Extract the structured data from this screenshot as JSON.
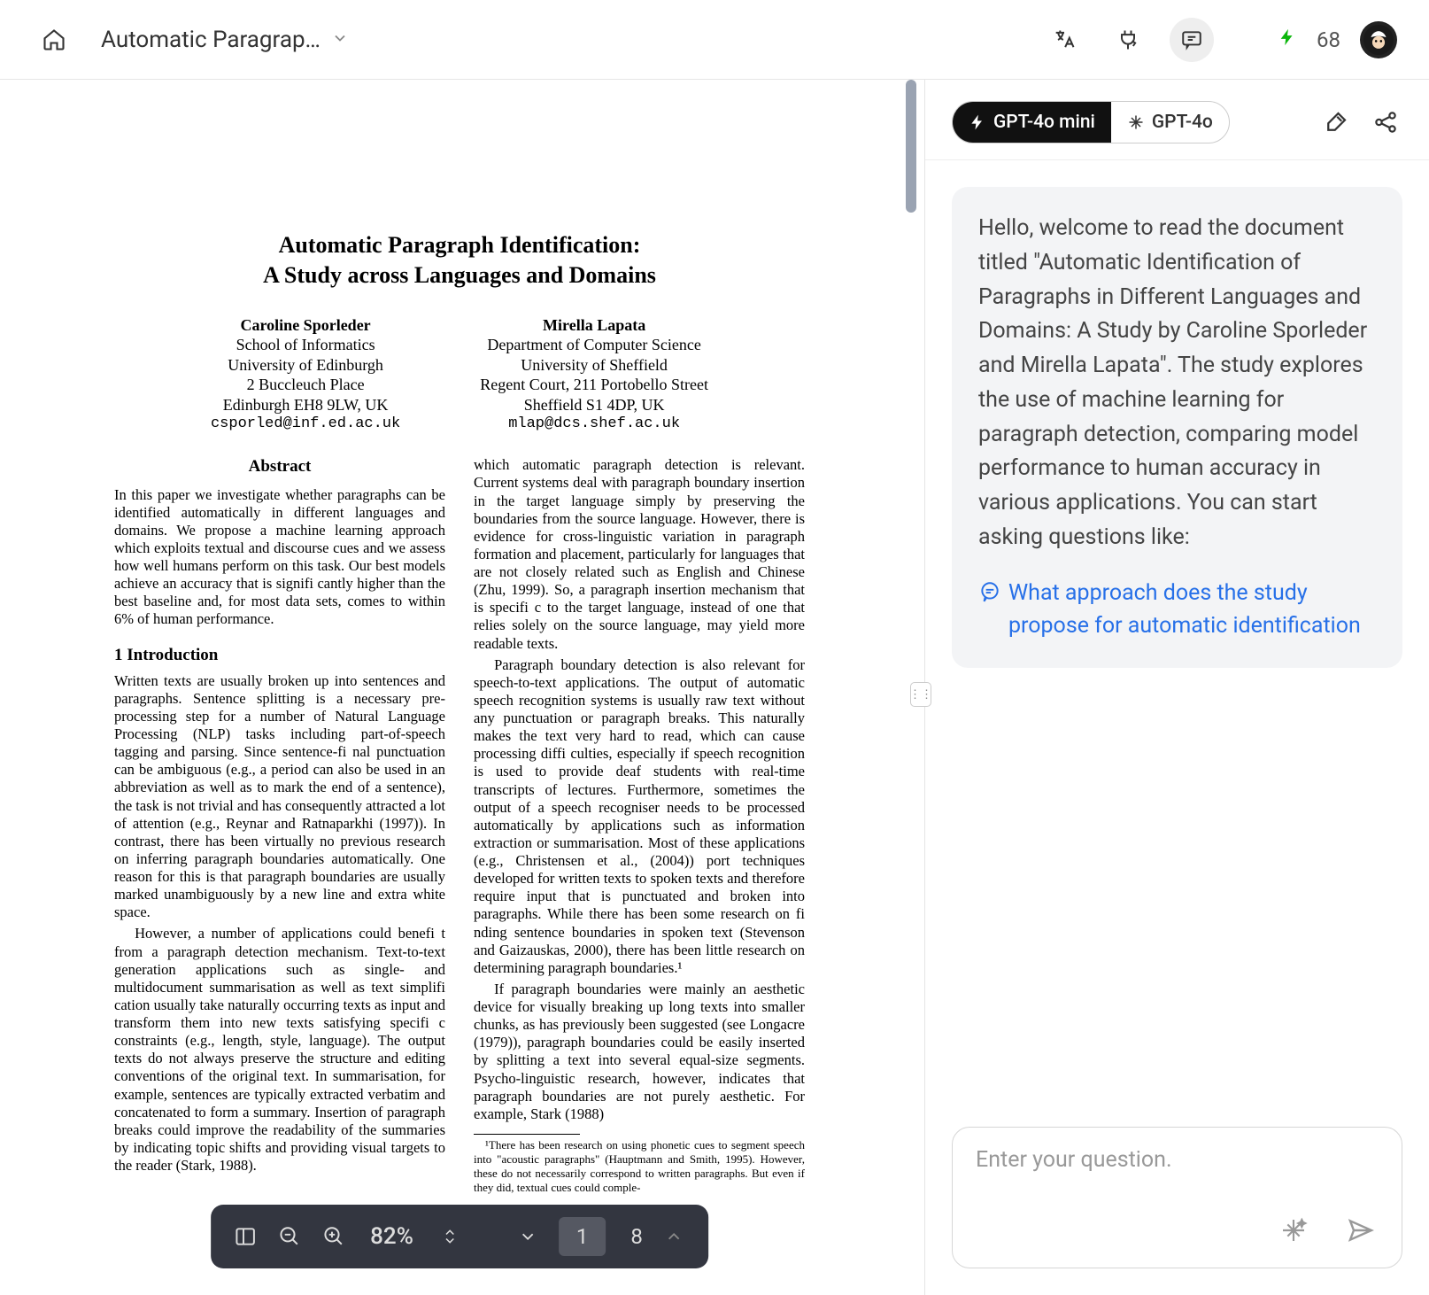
{
  "header": {
    "doc_title": "Automatic Paragrap…",
    "token_count": "68"
  },
  "pdf": {
    "toolbar": {
      "zoom": "82%",
      "current_page": "1",
      "total_pages": "8"
    },
    "paper": {
      "title_line1": "Automatic Paragraph Identification:",
      "title_line2": "A Study across Languages and Domains",
      "authors": [
        {
          "name": "Caroline Sporleder",
          "line1": "School of Informatics",
          "line2": "University of Edinburgh",
          "line3": "2 Buccleuch Place",
          "line4": "Edinburgh EH8 9LW, UK",
          "email": "csporled@inf.ed.ac.uk"
        },
        {
          "name": "Mirella Lapata",
          "line1": "Department of Computer Science",
          "line2": "University of Sheffield",
          "line3": "Regent Court, 211 Portobello Street",
          "line4": "Sheffield S1 4DP, UK",
          "email": "mlap@dcs.shef.ac.uk"
        }
      ],
      "abstract_heading": "Abstract",
      "abstract_body": "In this paper we investigate whether paragraphs can be identified automatically in different languages and domains. We propose a machine learning approach which exploits textual and discourse cues and we assess how well humans perform on this task. Our best models achieve an accuracy that is signifi cantly higher than the best baseline and, for most data sets, comes to within 6% of human performance.",
      "intro_heading": "1   Introduction",
      "intro_p1": "Written texts are usually broken up into sentences and paragraphs. Sentence splitting is a necessary pre-processing step for a number of Natural Language Processing (NLP) tasks including part-of-speech tagging and parsing. Since sentence-fi nal punctuation can be ambiguous (e.g., a period can also be used in an abbreviation as well as to mark the end of a sentence), the task is not trivial and has consequently attracted a lot of attention (e.g., Reynar and Ratnaparkhi (1997)). In contrast, there has been virtually no previous research on inferring paragraph boundaries automatically. One reason for this is that paragraph boundaries are usually marked unambiguously by a new line and extra white space.",
      "intro_p2": "However, a number of applications could benefi t from a paragraph detection mechanism. Text-to-text generation applications such as single- and multidocument summarisation as well as text simplifi cation usually take naturally occurring texts as input and transform them into new texts satisfying specifi c constraints (e.g., length, style, language). The output texts do not always preserve the structure and editing conventions of the original text. In summarisation, for example, sentences are typically extracted verbatim and concatenated to form a summary. Insertion of paragraph breaks could improve the readability of the summaries by indicating topic shifts and providing visual targets to the reader (Stark, 1988).",
      "col2_p1": "which automatic paragraph detection is relevant. Current systems deal with paragraph boundary insertion in the target language simply by preserving the boundaries from the source language. However, there is evidence for cross-linguistic variation in paragraph formation and placement, particularly for languages that are not closely related such as English and Chinese (Zhu, 1999). So, a paragraph insertion mechanism that is specifi c to the target language, instead of one that relies solely on the source language, may yield more readable texts.",
      "col2_p2": "Paragraph boundary detection is also relevant for speech-to-text applications. The output of automatic speech recognition systems is usually raw text without any punctuation or paragraph breaks. This naturally makes the text very hard to read, which can cause processing diffi culties, especially if speech recognition is used to provide deaf students with real-time transcripts of lectures. Furthermore, sometimes the output of a speech recogniser needs to be processed automatically by applications such as information extraction or summarisation. Most of these applications (e.g., Christensen et al., (2004)) port techniques developed for written texts to spoken texts and therefore require input that is punctuated and broken into paragraphs. While there has been some research on fi nding sentence boundaries in spoken text (Stevenson and Gaizauskas, 2000), there has been little research on determining paragraph boundaries.¹",
      "col2_p3": "If paragraph boundaries were mainly an aesthetic device for visually breaking up long texts into smaller chunks, as has previously been suggested (see Longacre (1979)), paragraph boundaries could be easily inserted by splitting a text into several equal-size segments. Psycho-linguistic research, however, indicates that paragraph boundaries are not purely aesthetic. For example, Stark (1988)",
      "footnote": "¹There has been research on using phonetic cues to segment speech into \"acoustic paragraphs\" (Hauptmann and Smith, 1995). However, these do not necessarily correspond to written paragraphs. But even if they did, textual cues could comple-"
    }
  },
  "chat": {
    "models": {
      "selected": "GPT-4o mini",
      "other": "GPT-4o"
    },
    "welcome": "Hello, welcome to read the document titled \"Automatic Identification of Paragraphs in Different Languages and Domains: A Study by Caroline Sporleder and Mirella Lapata\". The study explores the use of machine learning for paragraph detection, comparing model performance to human accuracy in various applications. You can start asking questions like:",
    "suggestion": "What approach does the study propose for automatic identification",
    "input_placeholder": "Enter your question."
  }
}
